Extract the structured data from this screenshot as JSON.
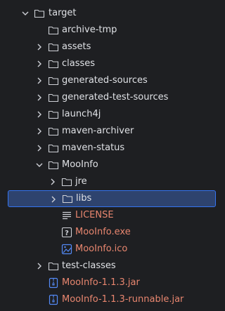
{
  "tree": {
    "target": "target",
    "archive_tmp": "archive-tmp",
    "assets": "assets",
    "classes": "classes",
    "generated_sources": "generated-sources",
    "generated_test_sources": "generated-test-sources",
    "launch4j": "launch4j",
    "maven_archiver": "maven-archiver",
    "maven_status": "maven-status",
    "mooinfo": "MooInfo",
    "jre": "jre",
    "libs": "libs",
    "license": "LICENSE",
    "mooinfo_exe": "MooInfo.exe",
    "mooinfo_ico": "MooInfo.ico",
    "test_classes": "test-classes",
    "jar": "MooInfo-1.1.3.jar",
    "runnable_jar": "MooInfo-1.1.3-runnable.jar"
  },
  "colors": {
    "background": "#1e1f22",
    "selection": "#2e436e",
    "selection_border": "#3574f0",
    "text": "#dfe1e5",
    "ignored_text": "#e8866f",
    "icon": "#ced0d6",
    "file_blue": "#548af7"
  }
}
